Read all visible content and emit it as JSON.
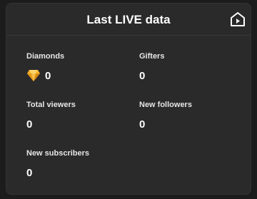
{
  "header": {
    "title": "Last LIVE data"
  },
  "icons": {
    "live_studio": "live-studio-icon",
    "diamond": "diamond-icon"
  },
  "stats": {
    "diamonds": {
      "label": "Diamonds",
      "value": "0"
    },
    "gifters": {
      "label": "Gifters",
      "value": "0"
    },
    "total_viewers": {
      "label": "Total viewers",
      "value": "0"
    },
    "new_followers": {
      "label": "New followers",
      "value": "0"
    },
    "new_subscribers": {
      "label": "New subscribers",
      "value": "0"
    }
  },
  "colors": {
    "background": "#1c1c1c",
    "card": "#2a2a2a",
    "text": "#ffffff",
    "diamond": "#f5b52a"
  }
}
